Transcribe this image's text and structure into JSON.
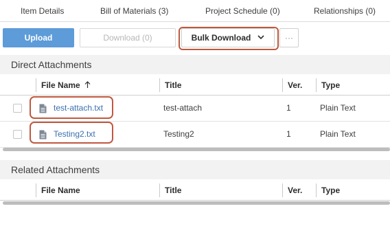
{
  "tabs": [
    {
      "label": "Item Details"
    },
    {
      "label": "Bill of Materials (3)"
    },
    {
      "label": "Project Schedule (0)"
    },
    {
      "label": "Relationships (0)"
    }
  ],
  "toolbar": {
    "upload_label": "Upload",
    "download_label": "Download (0)",
    "bulk_download_label": "Bulk Download",
    "more_label": "···"
  },
  "direct": {
    "title": "Direct Attachments",
    "columns": {
      "file_name": "File Name",
      "title": "Title",
      "version": "Ver.",
      "type": "Type"
    },
    "rows": [
      {
        "file_name": "test-attach.txt",
        "title": "test-attach",
        "version": "1",
        "type": "Plain Text"
      },
      {
        "file_name": "Testing2.txt",
        "title": "Testing2",
        "version": "1",
        "type": "Plain Text"
      }
    ]
  },
  "related": {
    "title": "Related Attachments",
    "columns": {
      "file_name": "File Name",
      "title": "Title",
      "version": "Ver.",
      "type": "Type"
    }
  },
  "colors": {
    "primary": "#5e9bd9",
    "link": "#3a6fae",
    "highlight": "#c0583f"
  },
  "icons": {
    "sort": "arrow-up-icon",
    "file": "document-icon",
    "dropdown": "chevron-down-icon",
    "more": "more-icon"
  }
}
